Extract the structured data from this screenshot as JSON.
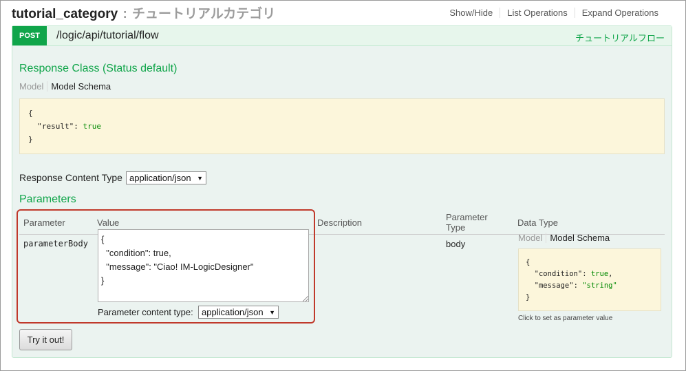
{
  "header": {
    "resource_name": "tutorial_category",
    "separator": ":",
    "resource_desc": "チュートリアルカテゴリ",
    "operations": [
      "Show/Hide",
      "List Operations",
      "Expand Operations"
    ]
  },
  "operation": {
    "method": "POST",
    "path": "/logic/api/tutorial/flow",
    "summary": "チュートリアルフロー",
    "response_class_title": "Response Class (Status default)",
    "model_tab": "Model",
    "schema_tab": "Model Schema",
    "response_schema_lines": [
      "{",
      "  \"result\": true",
      "}"
    ],
    "response_content_type_label": "Response Content Type",
    "response_content_type_value": "application/json",
    "parameters_title": "Parameters",
    "columns": [
      "Parameter",
      "Value",
      "Description",
      "Parameter Type",
      "Data Type"
    ],
    "param": {
      "name": "parameterBody",
      "value_text": "{\n  \"condition\": true,\n  \"message\": \"Ciao! IM-LogicDesigner\"\n}",
      "content_type_label": "Parameter content type:",
      "content_type_value": "application/json",
      "type": "body",
      "data_model_tab": "Model",
      "data_schema_tab": "Model Schema",
      "data_schema_lines": [
        "{",
        "  \"condition\": true,",
        "  \"message\": \"string\"",
        "}"
      ],
      "click_hint": "Click to set as parameter value"
    },
    "try_button": "Try it out!"
  },
  "colors": {
    "accent_green": "#10a54a",
    "highlight_red": "#c0392b",
    "snippet_bg": "#fcf6db"
  }
}
